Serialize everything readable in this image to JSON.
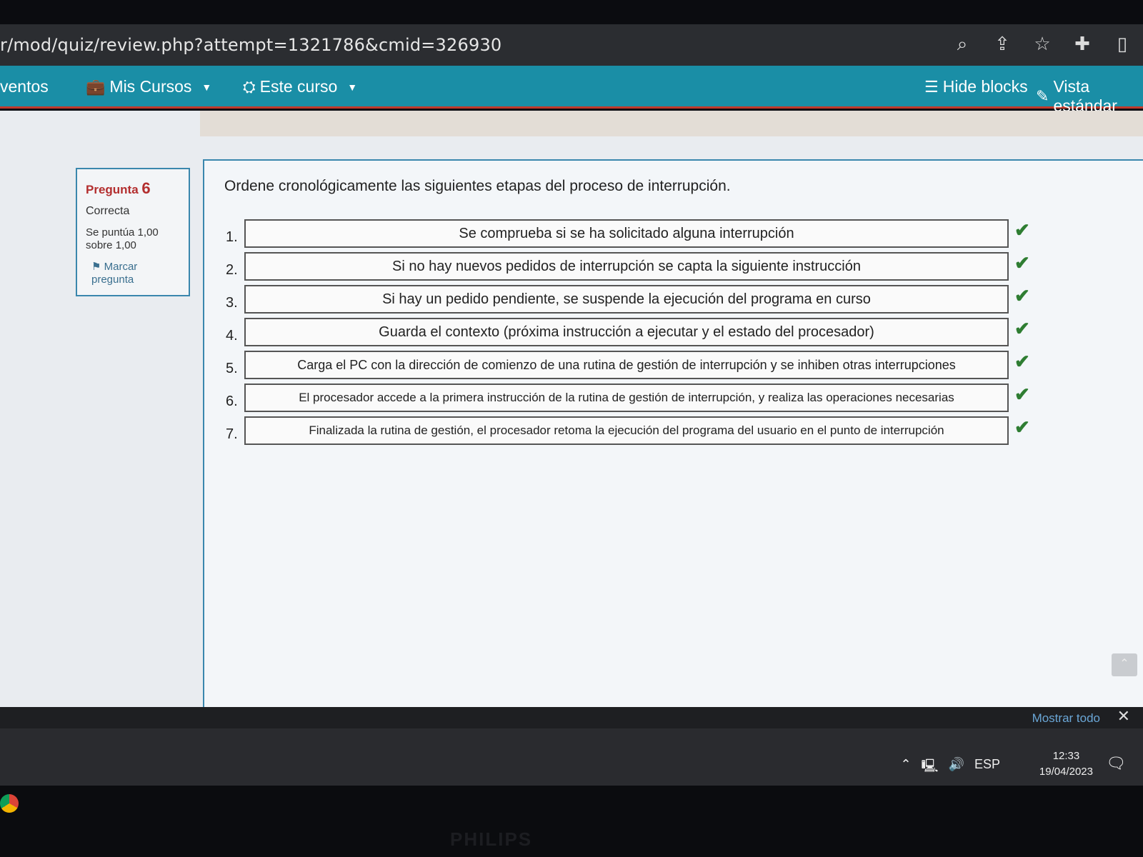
{
  "browser": {
    "url": "r/mod/quiz/review.php?attempt=1321786&cmid=326930",
    "icons": [
      "zoom-icon",
      "share-icon",
      "bookmark-star-icon",
      "extensions-icon",
      "side-panel-icon"
    ]
  },
  "navbar": {
    "eventos": "ventos",
    "mis_cursos": "Mis Cursos",
    "este_curso": "Este curso",
    "hide_blocks": "Hide blocks",
    "vista": "Vista estándar"
  },
  "question_info": {
    "pregunta_label": "Pregunta",
    "numero": "6",
    "estado": "Correcta",
    "puntua_line1": "Se puntúa 1,00",
    "puntua_line2": "sobre 1,00",
    "marcar_line1": "Marcar",
    "marcar_line2": "pregunta"
  },
  "question": {
    "text": "Ordene cronológicamente las siguientes etapas del proceso de interrupción.",
    "items": [
      {
        "num": "1.",
        "text": "Se comprueba si se ha solicitado alguna interrupción"
      },
      {
        "num": "2.",
        "text": "Si no hay nuevos pedidos de interrupción  se capta la siguiente instrucción"
      },
      {
        "num": "3.",
        "text": "Si hay un pedido pendiente, se suspende la ejecución del programa en curso"
      },
      {
        "num": "4.",
        "text": "Guarda el contexto (próxima instrucción a ejecutar y el estado del procesador)"
      },
      {
        "num": "5.",
        "text": "Carga el PC con la dirección de comienzo de una rutina de gestión de interrupción y se inhiben otras interrupciones"
      },
      {
        "num": "6.",
        "text": "El procesador accede a la primera instrucción de la rutina de gestión de interrupción, y realiza las operaciones necesarias"
      },
      {
        "num": "7.",
        "text": "Finalizada la rutina de gestión, el procesador retoma la ejecución del programa del usuario en el punto de interrupción"
      }
    ]
  },
  "downloads_bar": {
    "mostrar_todo": "Mostrar todo"
  },
  "taskbar": {
    "language": "ESP",
    "time": "12:33",
    "date": "19/04/2023"
  },
  "monitor": {
    "brand": "PHILIPS"
  },
  "colors": {
    "navbar": "#1a8ea6",
    "navbar_border": "#c0392b",
    "check": "#2e7d32",
    "pregunta": "#b32e2e"
  }
}
